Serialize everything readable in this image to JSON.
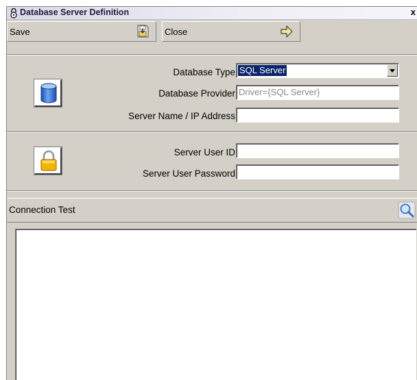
{
  "window": {
    "title": "Database Server Definition",
    "close_glyph": "x",
    "title_icon": "lock-icon"
  },
  "toolbar": {
    "save_label": "Save",
    "save_icon": "floppy-save-icon",
    "close_label": "Close",
    "close_icon": "arrow-exit-icon"
  },
  "database": {
    "icon": "database-cylinder-icon",
    "type_label": "Database Type",
    "type_value": "SQL Server",
    "provider_label": "Database Provider",
    "provider_value": "Driver={SQL Server}",
    "server_label": "Server Name / IP Address",
    "server_value": ""
  },
  "credentials": {
    "icon": "padlock-icon",
    "user_label": "Server User ID",
    "user_value": "",
    "password_label": "Server User Password",
    "password_value": ""
  },
  "connection_test": {
    "label": "Connection Test",
    "icon": "magnifier-icon",
    "output": ""
  },
  "colors": {
    "panel": "#d4d0c8",
    "selection": "#0a246a",
    "db_icon": "#2f6fd6",
    "lock_icon": "#f2b500"
  }
}
